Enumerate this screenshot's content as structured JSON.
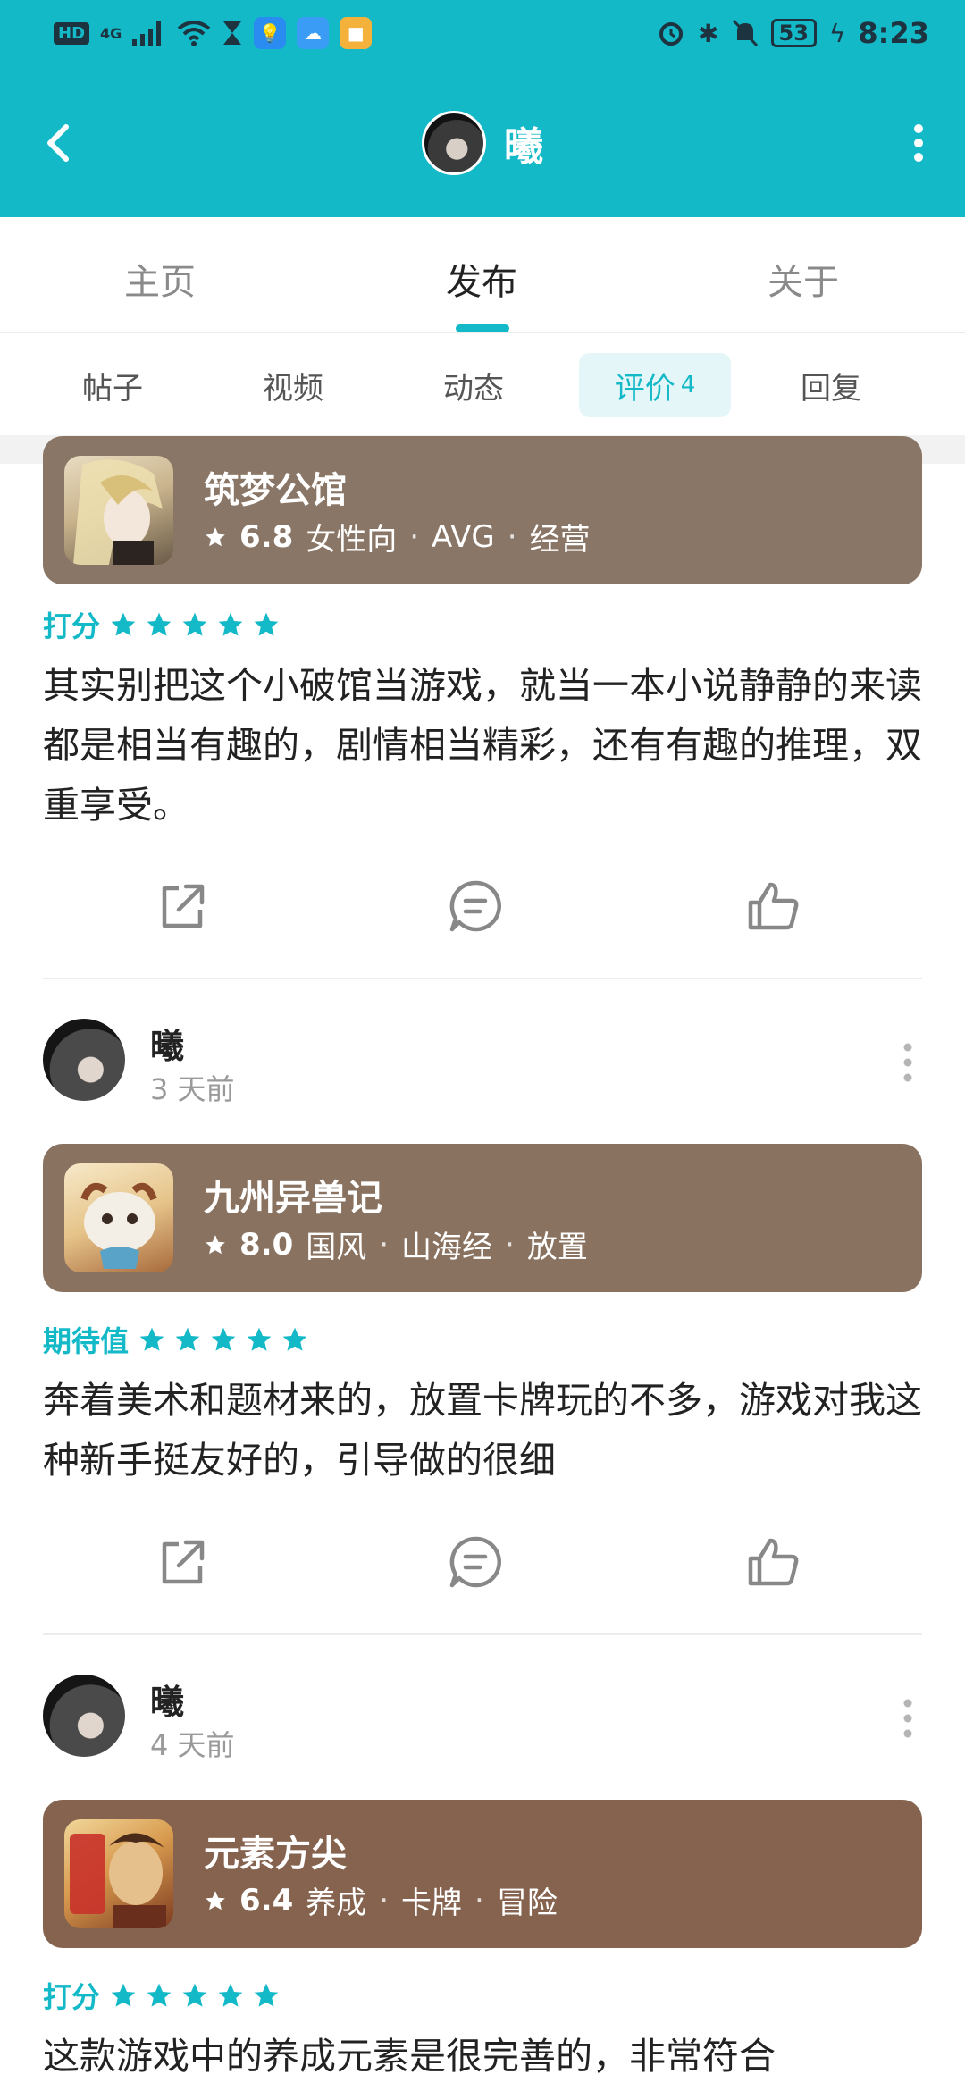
{
  "status_bar": {
    "left": {
      "hd": "HD",
      "network": "4G"
    },
    "right": {
      "battery": "53",
      "time": "8:23"
    }
  },
  "header": {
    "title": "曦",
    "back_icon": "chevron-left-icon",
    "more_icon": "more-vertical-icon",
    "background": "#14b9c8"
  },
  "main_tabs": [
    {
      "label": "主页"
    },
    {
      "label": "发布"
    },
    {
      "label": "关于"
    }
  ],
  "sub_tabs": [
    {
      "label": "帖子"
    },
    {
      "label": "视频"
    },
    {
      "label": "动态"
    },
    {
      "label": "评价",
      "count": "4"
    },
    {
      "label": "回复"
    }
  ],
  "accent_color": "#14b9c8",
  "feed": [
    {
      "game": {
        "name": "筑梦公馆",
        "score": "6.8",
        "tags": [
          "女性向",
          "AVG",
          "经营"
        ],
        "card_color": "#8a7666"
      },
      "rating_label": "打分",
      "stars": 5,
      "text": "其实别把这个小破馆当游戏，就当一本小说静静的来读都是相当有趣的，剧情相当精彩，还有有趣的推理，双重享受。"
    },
    {
      "user": {
        "name": "曦",
        "time": "3 天前"
      },
      "game": {
        "name": "九州异兽记",
        "score": "8.0",
        "tags": [
          "国风",
          "山海经",
          "放置"
        ],
        "card_color": "#8a7260"
      },
      "rating_label": "期待值",
      "stars": 5,
      "text": "奔着美术和题材来的，放置卡牌玩的不多，游戏对我这种新手挺友好的，引导做的很细"
    },
    {
      "user": {
        "name": "曦",
        "time": "4 天前"
      },
      "game": {
        "name": "元素方尖",
        "score": "6.4",
        "tags": [
          "养成",
          "卡牌",
          "冒险"
        ],
        "card_color": "#86634e"
      },
      "rating_label": "打分",
      "stars": 5,
      "text": "这款游戏中的养成元素是很完善的，非常符合"
    }
  ],
  "action_icons": [
    "share-icon",
    "comment-icon",
    "like-icon"
  ]
}
